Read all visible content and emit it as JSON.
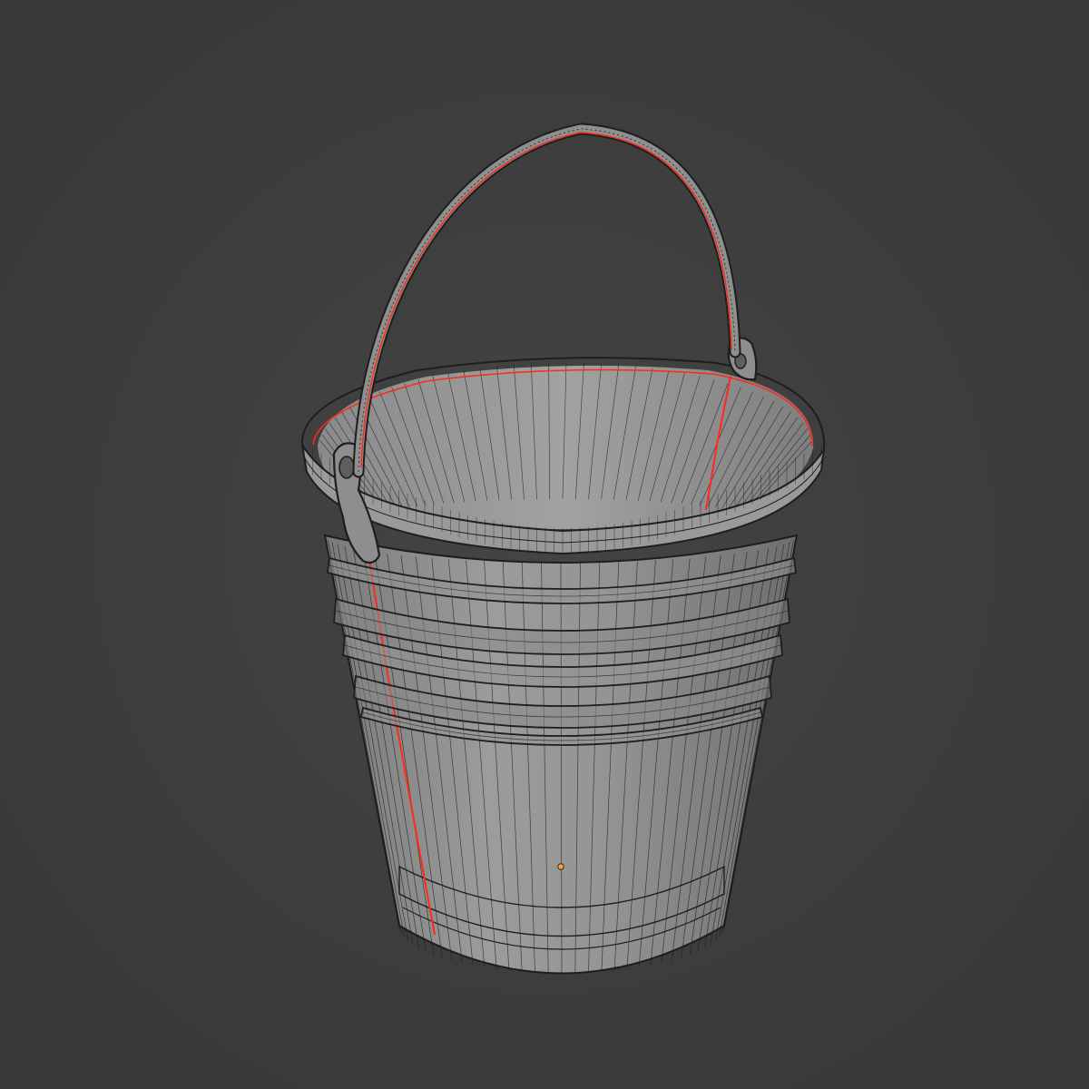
{
  "viewport": {
    "background_color": "#3d3d3d",
    "shading": "solid-wireframe-overlay"
  },
  "object": {
    "name": "bucket",
    "icon": "bucket-mesh-icon",
    "mesh_color": "#8f8f8f",
    "wire_color": "#1e1e1e",
    "seam_color": "#ff2a1a",
    "origin_color": "#ffa531",
    "parts": [
      "bucket-body",
      "bucket-rim",
      "bucket-rings",
      "bucket-handle",
      "handle-lugs"
    ]
  }
}
